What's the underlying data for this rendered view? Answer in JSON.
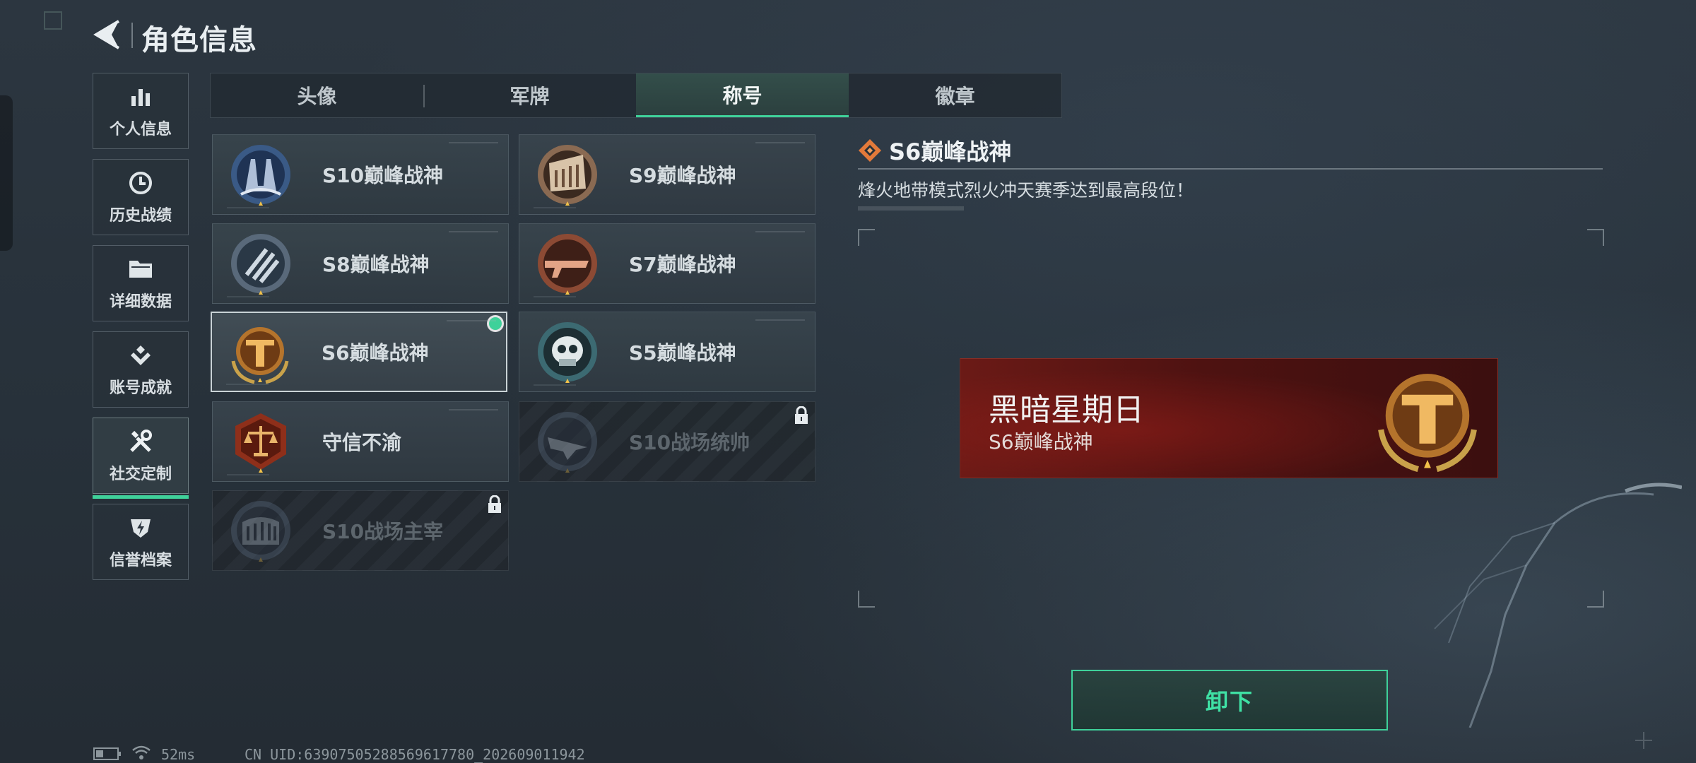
{
  "header": {
    "title": "角色信息"
  },
  "sidebar": {
    "items": [
      {
        "label": "个人信息",
        "icon": "bar-chart-icon"
      },
      {
        "label": "历史战绩",
        "icon": "history-clock-icon"
      },
      {
        "label": "详细数据",
        "icon": "folder-icon"
      },
      {
        "label": "账号成就",
        "icon": "achievement-icon"
      },
      {
        "label": "社交定制",
        "icon": "tools-icon",
        "active": true
      },
      {
        "label": "信誉档案",
        "icon": "credit-shield-icon"
      }
    ]
  },
  "tabs": [
    {
      "label": "头像"
    },
    {
      "label": "军牌"
    },
    {
      "label": "称号",
      "active": true
    },
    {
      "label": "徽章"
    }
  ],
  "titles": [
    {
      "name": "S10巅峰战神",
      "locked": false,
      "equipped": false
    },
    {
      "name": "S9巅峰战神",
      "locked": false,
      "equipped": false
    },
    {
      "name": "S8巅峰战神",
      "locked": false,
      "equipped": false
    },
    {
      "name": "S7巅峰战神",
      "locked": false,
      "equipped": false
    },
    {
      "name": "S6巅峰战神",
      "locked": false,
      "equipped": true
    },
    {
      "name": "S5巅峰战神",
      "locked": false,
      "equipped": false
    },
    {
      "name": "守信不渝",
      "locked": false,
      "equipped": false
    },
    {
      "name": "S10战场统帅",
      "locked": true,
      "equipped": false
    },
    {
      "name": "S10战场主宰",
      "locked": true,
      "equipped": false
    }
  ],
  "detail": {
    "title": "S6巅峰战神",
    "description": "烽火地带模式烈火冲天赛季达到最高段位！"
  },
  "preview": {
    "player_name": "黑暗星期日",
    "title": "S6巅峰战神"
  },
  "actions": {
    "unequip_label": "卸下"
  },
  "status_bar": {
    "ping": "52ms",
    "uid": "CN UID:6390750528856​9617780_202609011942"
  },
  "colors": {
    "accent": "#3fd19a",
    "banner_red": "#6b1a16"
  }
}
